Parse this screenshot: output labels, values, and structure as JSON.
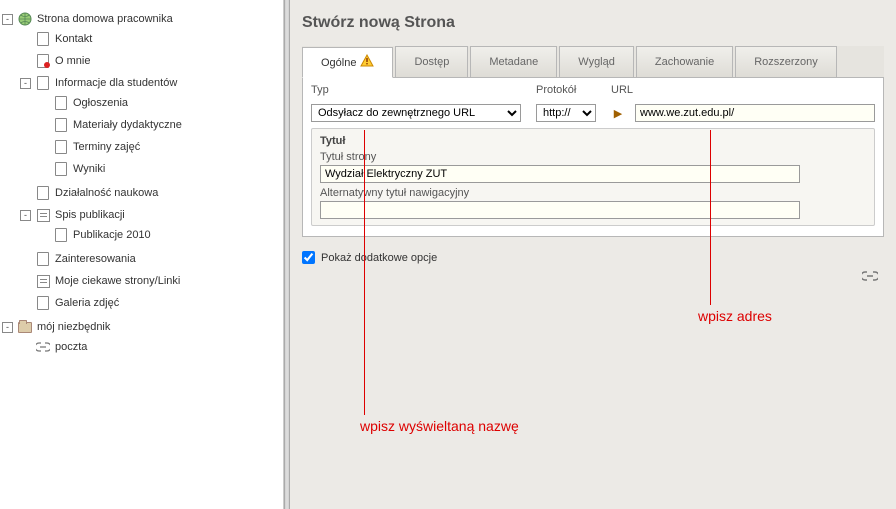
{
  "sidebar": {
    "items": [
      {
        "label": "Strona domowa pracownika",
        "icon": "globe",
        "toggle": "-",
        "children": [
          {
            "label": "Kontakt",
            "icon": "page"
          },
          {
            "label": "O mnie",
            "icon": "page-red"
          },
          {
            "label": "Informacje dla studentów",
            "icon": "page",
            "toggle": "-",
            "children": [
              {
                "label": "Ogłoszenia",
                "icon": "page"
              },
              {
                "label": "Materiały dydaktyczne",
                "icon": "page"
              },
              {
                "label": "Terminy zajęć",
                "icon": "page"
              },
              {
                "label": "Wyniki",
                "icon": "page"
              }
            ]
          },
          {
            "label": "Działalność naukowa",
            "icon": "page"
          },
          {
            "label": "Spis publikacji",
            "icon": "list",
            "toggle": "-",
            "children": [
              {
                "label": "Publikacje 2010",
                "icon": "page"
              }
            ]
          },
          {
            "label": "Zainteresowania",
            "icon": "page"
          },
          {
            "label": "Moje ciekawe strony/Linki",
            "icon": "list"
          },
          {
            "label": "Galeria zdjęć",
            "icon": "page"
          }
        ]
      },
      {
        "label": "mój niezbędnik",
        "icon": "folder",
        "toggle": "-",
        "children": [
          {
            "label": "poczta",
            "icon": "link"
          }
        ]
      }
    ]
  },
  "main": {
    "title": "Stwórz nową Strona",
    "tabs": [
      {
        "label": "Ogólne",
        "active": true,
        "warn": true
      },
      {
        "label": "Dostęp"
      },
      {
        "label": "Metadane"
      },
      {
        "label": "Wygląd"
      },
      {
        "label": "Zachowanie"
      },
      {
        "label": "Rozszerzony"
      }
    ],
    "type_label": "Typ",
    "type_value": "Odsyłacz do zewnętrznego URL",
    "protocol_label": "Protokół",
    "protocol_value": "http://",
    "url_label": "URL",
    "url_value": "www.we.zut.edu.pl/",
    "section_title": "Tytuł",
    "title_label": "Tytuł strony",
    "title_value": "Wydział Elektryczny ZUT",
    "alt_title_label": "Alternatywny tytuł nawigacyjny",
    "alt_title_value": "",
    "checkbox_label": "Pokaż dodatkowe opcje"
  },
  "annotations": {
    "right": "wpisz adres",
    "bottom": "wpisz wyświeltaną nazwę"
  }
}
